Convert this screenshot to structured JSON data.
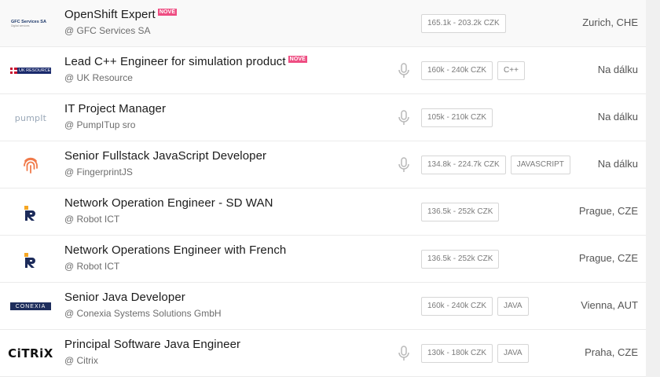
{
  "badge_new": "NOVÉ",
  "jobs": [
    {
      "title": "OpenShift Expert",
      "is_new": true,
      "company": "@ GFC Services SA",
      "logo_text": "GFC Services SA",
      "logo_sub": "Digital services",
      "has_mic": false,
      "tags": [
        "165.1k - 203.2k CZK"
      ],
      "location": "Zurich, CHE"
    },
    {
      "title": "Lead C++ Engineer for simulation product",
      "is_new": true,
      "company": "@ UK Resource",
      "logo_text": "UK RESOURCE",
      "has_mic": true,
      "tags": [
        "160k - 240k CZK",
        "C++"
      ],
      "location": "Na dálku"
    },
    {
      "title": "IT Project Manager",
      "is_new": false,
      "company": "@ PumpITup sro",
      "logo_text": "pumpIt",
      "has_mic": true,
      "tags": [
        "105k - 210k CZK"
      ],
      "location": "Na dálku"
    },
    {
      "title": "Senior Fullstack JavaScript Developer",
      "is_new": false,
      "company": "@ FingerprintJS",
      "has_mic": true,
      "tags": [
        "134.8k - 224.7k CZK",
        "JAVASCRIPT"
      ],
      "location": "Na dálku"
    },
    {
      "title": "Network Operation Engineer - SD WAN",
      "is_new": false,
      "company": "@ Robot ICT",
      "has_mic": false,
      "tags": [
        "136.5k - 252k CZK"
      ],
      "location": "Prague, CZE"
    },
    {
      "title": "Network Operations Engineer with French",
      "is_new": false,
      "company": "@ Robot ICT",
      "has_mic": false,
      "tags": [
        "136.5k - 252k CZK"
      ],
      "location": "Prague, CZE"
    },
    {
      "title": "Senior Java Developer",
      "is_new": false,
      "company": "@ Conexia Systems Solutions GmbH",
      "logo_text": "CONEXIA",
      "has_mic": false,
      "tags": [
        "160k - 240k CZK",
        "JAVA"
      ],
      "location": "Vienna, AUT"
    },
    {
      "title": "Principal Software Java Engineer",
      "is_new": false,
      "company": "@ Citrix",
      "logo_text": "CiTRiX",
      "has_mic": true,
      "tags": [
        "130k - 180k CZK",
        "JAVA"
      ],
      "location": "Praha, CZE"
    }
  ],
  "colors": {
    "new_badge": "#ee4d82",
    "title": "#1b1b1b",
    "fingerprint": "#f07a4a",
    "robot_orange": "#f5a623",
    "robot_navy": "#1c2b5a",
    "citrix": "#111111",
    "conexia_bg": "#1d2d5c",
    "uk_bg": "#1a2a6c"
  }
}
